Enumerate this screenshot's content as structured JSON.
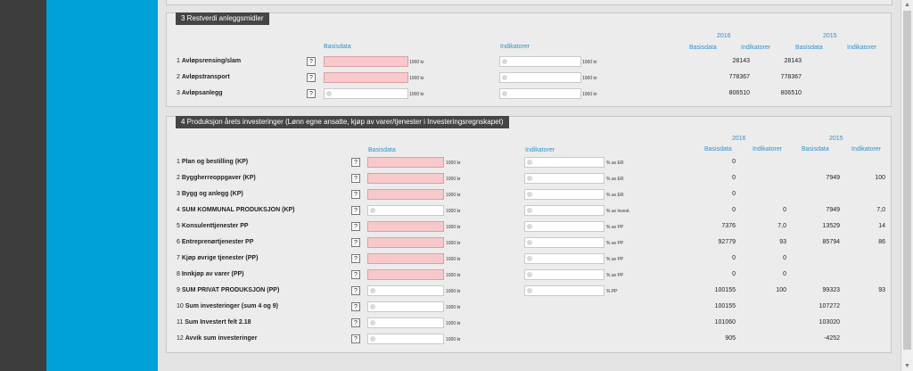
{
  "colors": {
    "sidebar_dark": "#3d3d3d",
    "sidebar_blue": "#00a0d8",
    "header_blue": "#2f93c8",
    "input_pink": "#f7c9cc",
    "title_bg": "#454545"
  },
  "help_label": "?",
  "section3": {
    "title": "3  Restverdi anleggsmidler",
    "col_basisdata": "Basisdata",
    "col_indikatorer": "Indikatorer",
    "year_2016": "2016",
    "year_2015": "2015",
    "sub_basisdata": "Basisdata",
    "sub_indikatorer": "Indikatorer",
    "rows": [
      {
        "num": "1",
        "label": "Avløpsrensing/slam",
        "unit1": "1000 kr",
        "unit2": "1000 kr",
        "v2016_basis": "28143",
        "v2016_ind": "28143",
        "v2015_basis": "",
        "v2015_ind": ""
      },
      {
        "num": "2",
        "label": "Avløpstransport",
        "unit1": "1000 kr",
        "unit2": "1000 kr",
        "v2016_basis": "778367",
        "v2016_ind": "778367",
        "v2015_basis": "",
        "v2015_ind": ""
      },
      {
        "num": "3",
        "label": "Avløpsanlegg",
        "unit1": "1000 kr",
        "unit2": "1000 kr",
        "v2016_basis": "806510",
        "v2016_ind": "806510",
        "v2015_basis": "",
        "v2015_ind": ""
      }
    ]
  },
  "section4": {
    "title": "4  Produksjon årets investeringer (Lønn egne ansatte, kjøp av varer/tjenester i Investeringsregnskapet)",
    "col_basisdata": "Basisdata",
    "col_indikatorer": "Indikatorer",
    "year_2016": "2016",
    "year_2015": "2015",
    "sub_basisdata": "Basisdata",
    "sub_indikatorer": "Indikatorer",
    "rows": [
      {
        "num": "1",
        "label": "Plan og bestilling (KP)",
        "unit1": "1000 kr",
        "unit2": "% av ER",
        "v2016_basis": "0",
        "v2016_ind": "",
        "v2015_basis": "",
        "v2015_ind": ""
      },
      {
        "num": "2",
        "label": "Byggherreoppgaver (KP)",
        "unit1": "1000 kr",
        "unit2": "% av ER",
        "v2016_basis": "0",
        "v2016_ind": "",
        "v2015_basis": "7949",
        "v2015_ind": "100"
      },
      {
        "num": "3",
        "label": "Bygg og anlegg (KP)",
        "unit1": "1000 kr",
        "unit2": "% av ER",
        "v2016_basis": "0",
        "v2016_ind": "",
        "v2015_basis": "",
        "v2015_ind": ""
      },
      {
        "num": "4",
        "label": "SUM KOMMUNAL PRODUKSJON (KP)",
        "unit1": "1000 kr",
        "unit2": "% av invest.",
        "v2016_basis": "0",
        "v2016_ind": "0",
        "v2015_basis": "7949",
        "v2015_ind": "7,0"
      },
      {
        "num": "5",
        "label": "Konsulenttjenester PP",
        "unit1": "1000 kr",
        "unit2": "% av PP",
        "v2016_basis": "7376",
        "v2016_ind": "7,0",
        "v2015_basis": "13529",
        "v2015_ind": "14"
      },
      {
        "num": "6",
        "label": "Entreprenørtjenester PP",
        "unit1": "1000 kr",
        "unit2": "% av PP",
        "v2016_basis": "92779",
        "v2016_ind": "93",
        "v2015_basis": "85794",
        "v2015_ind": "86"
      },
      {
        "num": "7",
        "label": "Kjøp øvrige tjenester (PP)",
        "unit1": "1000 kr",
        "unit2": "% av PP",
        "v2016_basis": "0",
        "v2016_ind": "0",
        "v2015_basis": "",
        "v2015_ind": ""
      },
      {
        "num": "8",
        "label": "Innkjøp av varer (PP)",
        "unit1": "1000 kr",
        "unit2": "% av PP",
        "v2016_basis": "0",
        "v2016_ind": "0",
        "v2015_basis": "",
        "v2015_ind": ""
      },
      {
        "num": "9",
        "label": "SUM PRIVAT PRODUKSJON (PP)",
        "unit1": "1000 kr",
        "unit2": "% PP",
        "v2016_basis": "100155",
        "v2016_ind": "100",
        "v2015_basis": "99323",
        "v2015_ind": "93"
      },
      {
        "num": "10",
        "label": "Sum investeringer (sum 4 og 9)",
        "unit1": "1000 kr",
        "unit2": "",
        "v2016_basis": "100155",
        "v2016_ind": "",
        "v2015_basis": "107272",
        "v2015_ind": ""
      },
      {
        "num": "11",
        "label": "Sum Investert felt 2.18",
        "unit1": "1000 kr",
        "unit2": "",
        "v2016_basis": "101060",
        "v2016_ind": "",
        "v2015_basis": "103020",
        "v2015_ind": ""
      },
      {
        "num": "12",
        "label": "Avvik sum investeringer",
        "unit1": "1000 kr",
        "unit2": "",
        "v2016_basis": "905",
        "v2016_ind": "",
        "v2015_basis": "-4252",
        "v2015_ind": ""
      }
    ]
  }
}
